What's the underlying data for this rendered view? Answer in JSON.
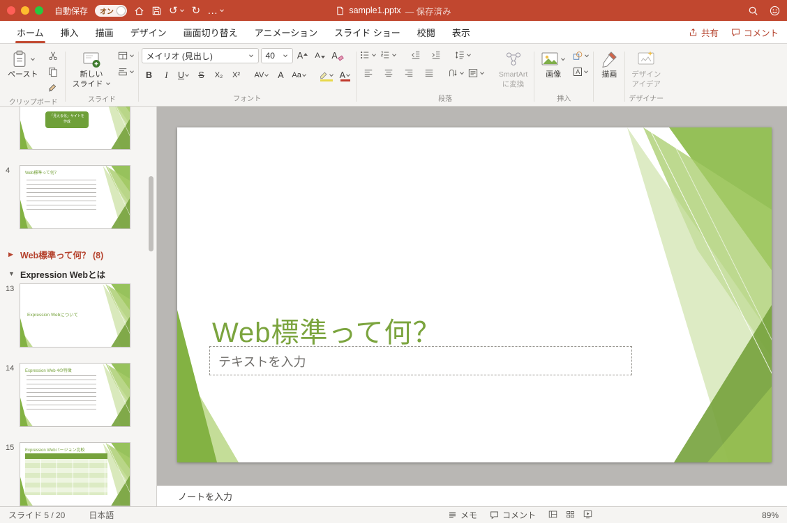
{
  "colors": {
    "titlebar": "#c1472f",
    "accent_red": "#b5432e",
    "tab_underline": "#c24b33",
    "green_dark": "#76a23c",
    "green_mid": "#8cbb4a",
    "green_light": "#b5d47e",
    "green_pale": "#d3e5b3",
    "slide_title_green": "#7ba43e"
  },
  "titlebar": {
    "autosave_label": "自動保存",
    "autosave_state": "オン",
    "doc_title": "sample1.pptx",
    "doc_status": "— 保存済み"
  },
  "tabs": [
    {
      "label": "ホーム"
    },
    {
      "label": "挿入"
    },
    {
      "label": "描画"
    },
    {
      "label": "デザイン"
    },
    {
      "label": "画面切り替え"
    },
    {
      "label": "アニメーション"
    },
    {
      "label": "スライド ショー"
    },
    {
      "label": "校閲"
    },
    {
      "label": "表示"
    }
  ],
  "actions": {
    "share": "共有",
    "comments": "コメント"
  },
  "ribbon": {
    "paste_label": "ペースト",
    "new_slide_line1": "新しい",
    "new_slide_line2": "スライド",
    "font_name": "メイリオ (見出し)",
    "font_size": "40",
    "smartart_line1": "SmartArt",
    "smartart_line2": "に変換",
    "picture_label": "画像",
    "draw_label": "描画",
    "design_line1": "デザイン",
    "design_line2": "アイデア",
    "group_labels": {
      "clipboard": "クリップボード",
      "slides": "スライド",
      "font": "フォント",
      "paragraph": "段落",
      "insert": "挿入",
      "designer": "デザイナー"
    }
  },
  "glyphs": {
    "triangle_collapsed": "▶",
    "triangle_expanded": "▼",
    "undo": "↺",
    "redo": "↻",
    "ellipsis": "…",
    "bold": "B",
    "italic": "I",
    "underline": "U",
    "strikethrough": "S",
    "subscript": "X₂",
    "superscript": "X²",
    "char_spacing": "AV",
    "char_outline": "A",
    "change_case": "Aa",
    "grow_font": "A",
    "shrink_font": "A",
    "clear_format": "A",
    "font_color": "A",
    "textbox_letter": "A"
  },
  "sidebar": {
    "sections": [
      {
        "label": "Web標準って何？ (8)",
        "collapsed": true
      },
      {
        "label": "Expression Webとは",
        "collapsed": false
      }
    ],
    "slides": [
      {
        "number": "",
        "callout": "「見える化」サイトを作成"
      },
      {
        "number": "4",
        "title": "Web標準って何？"
      },
      {
        "number": "13",
        "title": "Expression Webについて"
      },
      {
        "number": "14",
        "title": "Expression Web 4の特徴"
      },
      {
        "number": "15",
        "title": "Expression Webバージョン比較"
      }
    ]
  },
  "slide": {
    "title": "Web標準って何？",
    "body_placeholder": "テキストを入力"
  },
  "notes": {
    "placeholder": "ノートを入力"
  },
  "statusbar": {
    "slide_counter": "スライド 5 / 20",
    "language": "日本語",
    "notes_label": "メモ",
    "comments_label": "コメント",
    "zoom": "89%"
  }
}
